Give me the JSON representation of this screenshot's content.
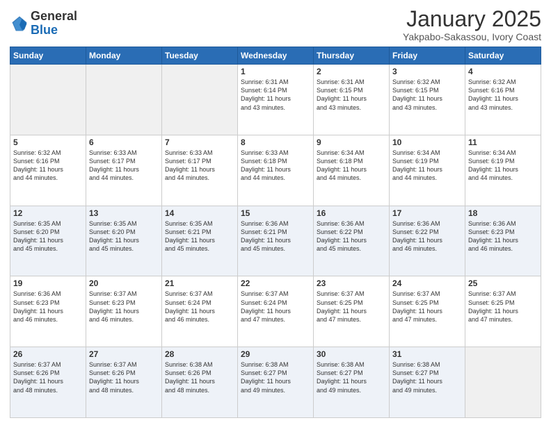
{
  "header": {
    "logo_general": "General",
    "logo_blue": "Blue",
    "month_title": "January 2025",
    "subtitle": "Yakpabo-Sakassou, Ivory Coast"
  },
  "weekdays": [
    "Sunday",
    "Monday",
    "Tuesday",
    "Wednesday",
    "Thursday",
    "Friday",
    "Saturday"
  ],
  "weeks": [
    [
      {
        "day": "",
        "info": ""
      },
      {
        "day": "",
        "info": ""
      },
      {
        "day": "",
        "info": ""
      },
      {
        "day": "1",
        "info": "Sunrise: 6:31 AM\nSunset: 6:14 PM\nDaylight: 11 hours\nand 43 minutes."
      },
      {
        "day": "2",
        "info": "Sunrise: 6:31 AM\nSunset: 6:15 PM\nDaylight: 11 hours\nand 43 minutes."
      },
      {
        "day": "3",
        "info": "Sunrise: 6:32 AM\nSunset: 6:15 PM\nDaylight: 11 hours\nand 43 minutes."
      },
      {
        "day": "4",
        "info": "Sunrise: 6:32 AM\nSunset: 6:16 PM\nDaylight: 11 hours\nand 43 minutes."
      }
    ],
    [
      {
        "day": "5",
        "info": "Sunrise: 6:32 AM\nSunset: 6:16 PM\nDaylight: 11 hours\nand 44 minutes."
      },
      {
        "day": "6",
        "info": "Sunrise: 6:33 AM\nSunset: 6:17 PM\nDaylight: 11 hours\nand 44 minutes."
      },
      {
        "day": "7",
        "info": "Sunrise: 6:33 AM\nSunset: 6:17 PM\nDaylight: 11 hours\nand 44 minutes."
      },
      {
        "day": "8",
        "info": "Sunrise: 6:33 AM\nSunset: 6:18 PM\nDaylight: 11 hours\nand 44 minutes."
      },
      {
        "day": "9",
        "info": "Sunrise: 6:34 AM\nSunset: 6:18 PM\nDaylight: 11 hours\nand 44 minutes."
      },
      {
        "day": "10",
        "info": "Sunrise: 6:34 AM\nSunset: 6:19 PM\nDaylight: 11 hours\nand 44 minutes."
      },
      {
        "day": "11",
        "info": "Sunrise: 6:34 AM\nSunset: 6:19 PM\nDaylight: 11 hours\nand 44 minutes."
      }
    ],
    [
      {
        "day": "12",
        "info": "Sunrise: 6:35 AM\nSunset: 6:20 PM\nDaylight: 11 hours\nand 45 minutes."
      },
      {
        "day": "13",
        "info": "Sunrise: 6:35 AM\nSunset: 6:20 PM\nDaylight: 11 hours\nand 45 minutes."
      },
      {
        "day": "14",
        "info": "Sunrise: 6:35 AM\nSunset: 6:21 PM\nDaylight: 11 hours\nand 45 minutes."
      },
      {
        "day": "15",
        "info": "Sunrise: 6:36 AM\nSunset: 6:21 PM\nDaylight: 11 hours\nand 45 minutes."
      },
      {
        "day": "16",
        "info": "Sunrise: 6:36 AM\nSunset: 6:22 PM\nDaylight: 11 hours\nand 45 minutes."
      },
      {
        "day": "17",
        "info": "Sunrise: 6:36 AM\nSunset: 6:22 PM\nDaylight: 11 hours\nand 46 minutes."
      },
      {
        "day": "18",
        "info": "Sunrise: 6:36 AM\nSunset: 6:23 PM\nDaylight: 11 hours\nand 46 minutes."
      }
    ],
    [
      {
        "day": "19",
        "info": "Sunrise: 6:36 AM\nSunset: 6:23 PM\nDaylight: 11 hours\nand 46 minutes."
      },
      {
        "day": "20",
        "info": "Sunrise: 6:37 AM\nSunset: 6:23 PM\nDaylight: 11 hours\nand 46 minutes."
      },
      {
        "day": "21",
        "info": "Sunrise: 6:37 AM\nSunset: 6:24 PM\nDaylight: 11 hours\nand 46 minutes."
      },
      {
        "day": "22",
        "info": "Sunrise: 6:37 AM\nSunset: 6:24 PM\nDaylight: 11 hours\nand 47 minutes."
      },
      {
        "day": "23",
        "info": "Sunrise: 6:37 AM\nSunset: 6:25 PM\nDaylight: 11 hours\nand 47 minutes."
      },
      {
        "day": "24",
        "info": "Sunrise: 6:37 AM\nSunset: 6:25 PM\nDaylight: 11 hours\nand 47 minutes."
      },
      {
        "day": "25",
        "info": "Sunrise: 6:37 AM\nSunset: 6:25 PM\nDaylight: 11 hours\nand 47 minutes."
      }
    ],
    [
      {
        "day": "26",
        "info": "Sunrise: 6:37 AM\nSunset: 6:26 PM\nDaylight: 11 hours\nand 48 minutes."
      },
      {
        "day": "27",
        "info": "Sunrise: 6:37 AM\nSunset: 6:26 PM\nDaylight: 11 hours\nand 48 minutes."
      },
      {
        "day": "28",
        "info": "Sunrise: 6:38 AM\nSunset: 6:26 PM\nDaylight: 11 hours\nand 48 minutes."
      },
      {
        "day": "29",
        "info": "Sunrise: 6:38 AM\nSunset: 6:27 PM\nDaylight: 11 hours\nand 49 minutes."
      },
      {
        "day": "30",
        "info": "Sunrise: 6:38 AM\nSunset: 6:27 PM\nDaylight: 11 hours\nand 49 minutes."
      },
      {
        "day": "31",
        "info": "Sunrise: 6:38 AM\nSunset: 6:27 PM\nDaylight: 11 hours\nand 49 minutes."
      },
      {
        "day": "",
        "info": ""
      }
    ]
  ]
}
